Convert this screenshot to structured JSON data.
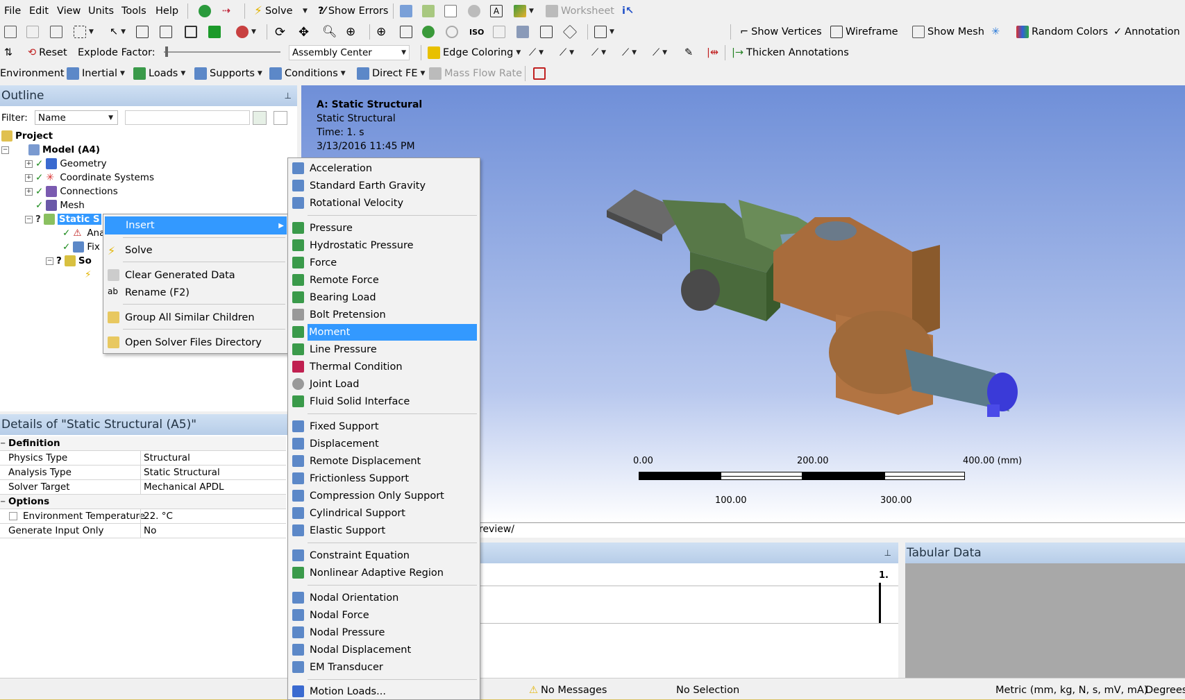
{
  "menubar": [
    "File",
    "Edit",
    "View",
    "Units",
    "Tools",
    "Help"
  ],
  "toolbar1": {
    "solve": "Solve",
    "show_errors": "Show Errors",
    "worksheet": "Worksheet"
  },
  "toolbar2": {
    "show_vertices": "Show Vertices",
    "wireframe": "Wireframe",
    "show_mesh": "Show Mesh",
    "random_colors": "Random Colors",
    "annotation": "Annotation"
  },
  "toolbar3": {
    "reset": "Reset",
    "explode_factor": "Explode Factor:",
    "assembly_select": "Assembly Center",
    "edge_coloring": "Edge Coloring",
    "thicken": "Thicken Annotations"
  },
  "toolbar4": {
    "environment": "Environment",
    "inertial": "Inertial",
    "loads": "Loads",
    "supports": "Supports",
    "conditions": "Conditions",
    "direct_fe": "Direct FE",
    "mass_flow": "Mass Flow Rate"
  },
  "outline": {
    "title": "Outline",
    "filter_label": "Filter:",
    "filter_value": "Name",
    "tree": {
      "project": "Project",
      "model": "Model (A4)",
      "geometry": "Geometry",
      "coord": "Coordinate Systems",
      "connections": "Connections",
      "mesh": "Mesh",
      "static": "Static S",
      "ana": "Ana",
      "fix": "Fix",
      "sol": "So"
    }
  },
  "details": {
    "title": "Details of \"Static Structural (A5)\"",
    "sections": [
      "Definition",
      "Options"
    ],
    "rows": [
      {
        "k": "Physics Type",
        "v": "Structural"
      },
      {
        "k": "Analysis Type",
        "v": "Static Structural"
      },
      {
        "k": "Solver Target",
        "v": "Mechanical APDL"
      },
      {
        "k": "Environment Temperature",
        "v": "22. °C"
      },
      {
        "k": "Generate Input Only",
        "v": "No"
      }
    ]
  },
  "context_menu": {
    "items": [
      "Insert",
      "Solve",
      "Clear Generated Data",
      "Rename (F2)",
      "Group All Similar Children",
      "Open Solver Files Directory"
    ]
  },
  "insert_menu": {
    "groups": [
      [
        "Acceleration",
        "Standard Earth Gravity",
        "Rotational Velocity"
      ],
      [
        "Pressure",
        "Hydrostatic Pressure",
        "Force",
        "Remote Force",
        "Bearing Load",
        "Bolt Pretension",
        "Moment",
        "Line Pressure",
        "Thermal Condition",
        "Joint Load",
        "Fluid Solid Interface"
      ],
      [
        "Fixed Support",
        "Displacement",
        "Remote Displacement",
        "Frictionless Support",
        "Compression Only Support",
        "Cylindrical Support",
        "Elastic Support"
      ],
      [
        "Constraint Equation",
        "Nonlinear Adaptive Region"
      ],
      [
        "Nodal Orientation",
        "Nodal Force",
        "Nodal Pressure",
        "Nodal Displacement",
        "EM Transducer"
      ],
      [
        "Motion Loads..."
      ]
    ],
    "selected": "Moment"
  },
  "viewport": {
    "title": "A: Static Structural",
    "sub": "Static Structural",
    "time": "Time: 1. s",
    "date": "3/13/2016 11:45 PM",
    "scale_top": [
      "0.00",
      "200.00",
      "400.00 (mm)"
    ],
    "scale_bottom": [
      "100.00",
      "300.00"
    ],
    "tab": "review/"
  },
  "graph": {
    "value": "1."
  },
  "tabular": {
    "title": "Tabular Data"
  },
  "statusbar": {
    "messages": "No Messages",
    "selection": "No Selection",
    "units": "Metric (mm, kg, N, s, mV, mA)",
    "angle": "Degrees"
  },
  "colors": {
    "accent": "#3399ff",
    "viewport_top": "#6f8fd8",
    "viewport_bottom": "#ffffff",
    "header": "#c3d6ee"
  }
}
